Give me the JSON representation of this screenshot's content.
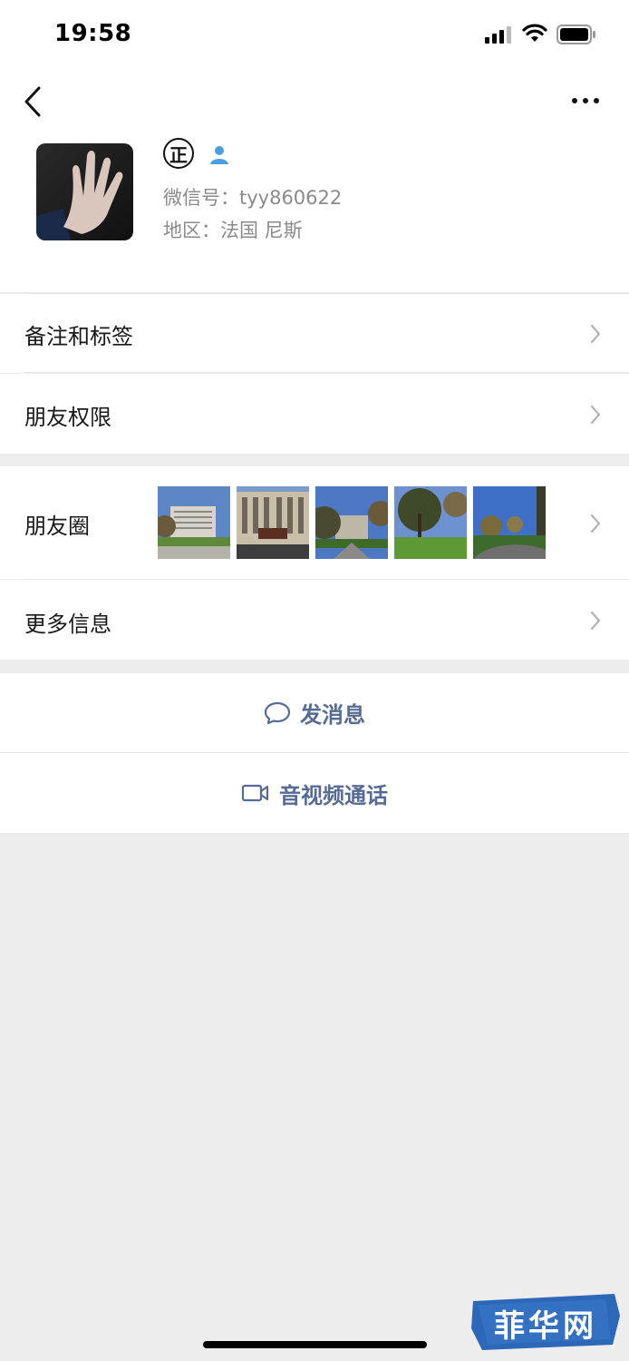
{
  "status_bar": {
    "time": "19:58"
  },
  "profile": {
    "badge": "正",
    "wechat_id": "微信号：tyy860622",
    "region": "地区：法国 尼斯"
  },
  "rows": {
    "remark_tags": "备注和标签",
    "friend_permissions": "朋友权限",
    "moments": "朋友圈",
    "more_info": "更多信息"
  },
  "actions": {
    "send_message": "发消息",
    "video_call": "音视频通话"
  },
  "watermark": {
    "text": "菲华网"
  },
  "colors": {
    "accent_link": "#576b95",
    "background": "#ededed",
    "secondary_text": "#8a8a8a"
  }
}
